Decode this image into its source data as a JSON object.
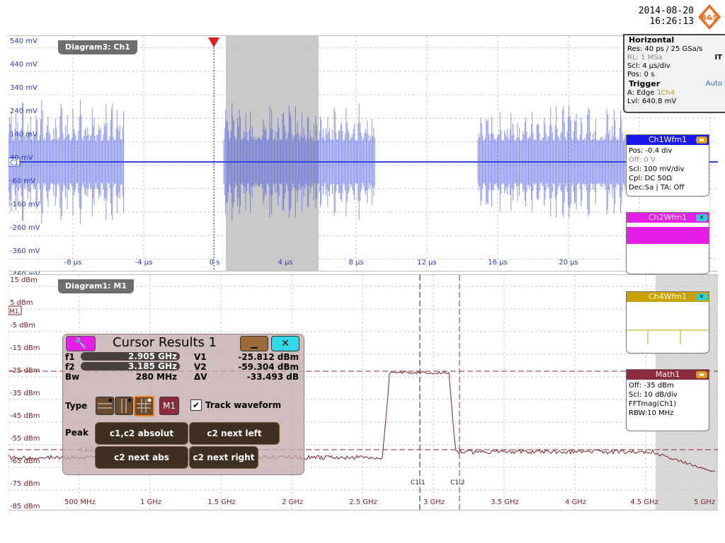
{
  "header": {
    "date": "2014-08-20",
    "time": "16:26:13",
    "logo_text": "R&S",
    "logo_color": "#f26a1b"
  },
  "diagram3": {
    "tab": "Diagram3: Ch1",
    "ylabels": [
      "540 mV",
      "440 mV",
      "340 mV",
      "240 mV",
      "140 mV",
      "40 mV",
      "-60 mV",
      "-160 mV",
      "-260 mV",
      "-360 mV",
      "-460 mV"
    ],
    "xlabels": [
      "-8 µs",
      "-4 µs",
      "0 s",
      "4 µs",
      "8 µs",
      "12 µs",
      "16 µs",
      "20 µs"
    ],
    "channel_marker": "C1",
    "trace_color": "#3344dd"
  },
  "diagram1": {
    "tab": "Diagram1: M1",
    "ylabels": [
      "15 dBm",
      "5 dBm",
      "-5 dBm",
      "-15 dBm",
      "-25 dBm",
      "-35 dBm",
      "-45 dBm",
      "-55 dBm",
      "-65 dBm",
      "-75 dBm",
      "-85 dBm"
    ],
    "xlabels": [
      "500 MHz",
      "1 GHz",
      "1.5 GHz",
      "2 GHz",
      "2.5 GHz",
      "3 GHz",
      "3.5 GHz",
      "4 GHz",
      "4.5 GHz",
      "5 GHz"
    ],
    "channel_marker": "M1",
    "cursor_labels": {
      "c11": "C1.1",
      "c12": "C1.2",
      "c12_left": "C1.2"
    },
    "trace_color": "#7a2222"
  },
  "horizontal": {
    "title": "Horizontal",
    "res": "Res: 40 ps / 25 GSa/s",
    "rl": "RL:   1 MSa",
    "it": "IT",
    "scl": "Scl:  4 µs/div",
    "pos": "Pos: 0 s",
    "trigger_title": "Trigger",
    "trigger_mode": "Auto",
    "trigger_a": "A:   Edge",
    "trigger_src": "Ch4",
    "trigger_lvl": "Lvl:  640.8 mV"
  },
  "ch1wfm": {
    "title": "Ch1Wfm1",
    "color": "#1a1af0",
    "lines": [
      "Pos: -0.4 div",
      "Off: 0 V",
      "Scl: 100 mV/div",
      "Cpl: DC 50Ω",
      "Dec:Sa | TA: Off"
    ]
  },
  "ch2wfm": {
    "title": "Ch2Wfm1",
    "color": "#e61ee6"
  },
  "ch4wfm": {
    "title": "Ch4Wfm1",
    "color": "#c8a000"
  },
  "math1": {
    "title": "Math1",
    "color": "#8b2b3b",
    "lines": [
      "Off:  -35 dBm",
      "Scl:  10 dB/div",
      "FFTmag(Ch1)",
      "RBW:10 MHz"
    ]
  },
  "cursor_results": {
    "title": "Cursor Results 1",
    "f1_label": "f1",
    "f1": "2.905 GHz",
    "f2_label": "f2",
    "f2": "3.185 GHz",
    "bw_label": "Bw",
    "bw": "280 MHz",
    "v1_label": "V1",
    "v1": "-25.812 dBm",
    "v2_label": "V2",
    "v2": "-59.304 dBm",
    "dv_label": "ΔV",
    "dv": "-33.493 dB",
    "type_label": "Type",
    "source_label": "M1",
    "track_label": "Track waveform",
    "track_checked": true,
    "peak_label": "Peak",
    "btn_c1c2": "c1,c2 absolut",
    "btn_next_left": "c2 next left",
    "btn_next_abs": "c2 next abs",
    "btn_next_right": "c2 next right"
  }
}
